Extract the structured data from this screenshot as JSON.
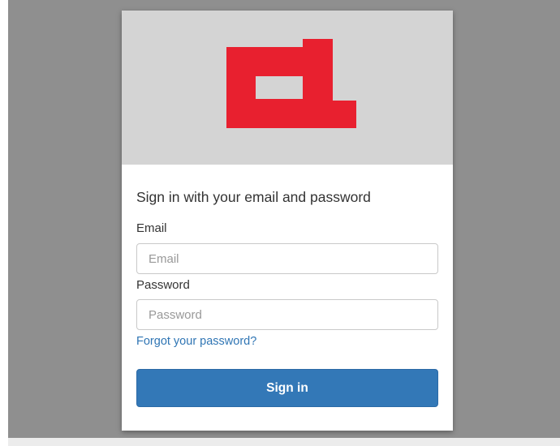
{
  "theme": {
    "banner_color": "#d4d4d4",
    "logo_color": "#e8202f",
    "button_color": "#3378b7",
    "link_color": "#2f75b4"
  },
  "logo": {
    "icon": "brand-logo-icon"
  },
  "form": {
    "heading": "Sign in with your email and password",
    "email": {
      "label": "Email",
      "placeholder": "Email",
      "value": ""
    },
    "password": {
      "label": "Password",
      "placeholder": "Password",
      "value": ""
    },
    "forgot_password_link": "Forgot your password?",
    "submit_label": "Sign in"
  }
}
